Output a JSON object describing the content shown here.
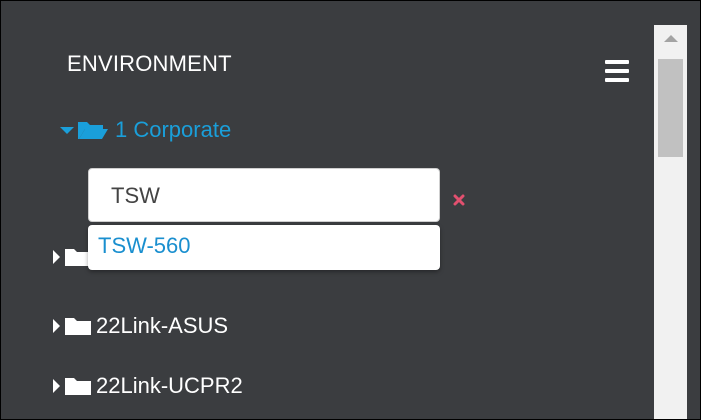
{
  "panel": {
    "title": "ENVIRONMENT"
  },
  "tree": {
    "root": {
      "label": "1 Corporate",
      "expanded": true
    },
    "items": [
      {
        "label": "22Link-ASUS"
      },
      {
        "label": "22Link-UCPR2"
      }
    ]
  },
  "search": {
    "value": "TSW",
    "suggestions": [
      "TSW-560"
    ]
  },
  "colors": {
    "panel_bg": "#3b3d40",
    "accent": "#1a9fda",
    "clear": "#e2506f",
    "text": "#ffffff"
  },
  "icons": {
    "menu": "hamburger-menu-icon",
    "clear": "close-icon",
    "folder_open": "folder-open-icon",
    "folder_closed": "folder-icon",
    "caret_down": "caret-down-icon",
    "caret_right": "caret-right-icon"
  }
}
